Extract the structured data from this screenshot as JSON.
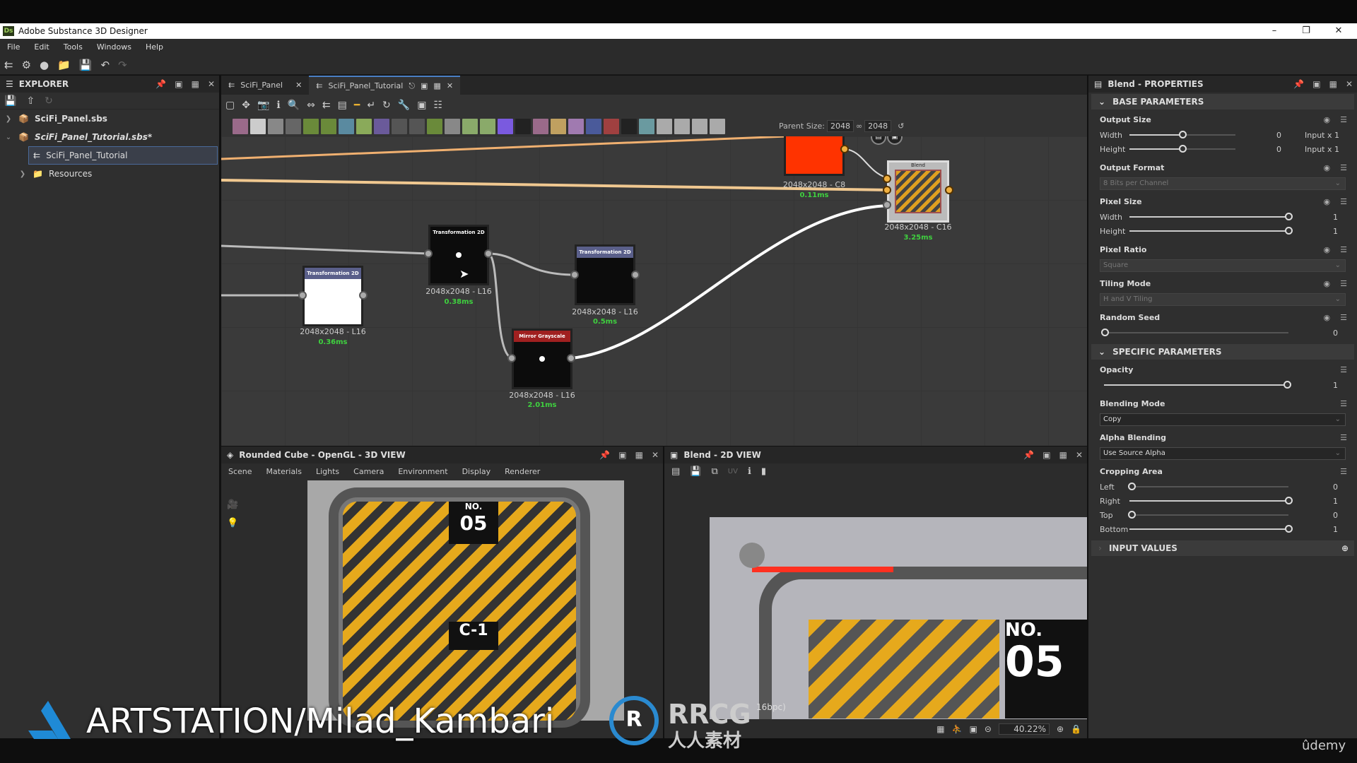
{
  "app": {
    "title": "Adobe Substance 3D Designer",
    "logo": "Ds"
  },
  "menu": [
    "File",
    "Edit",
    "Tools",
    "Windows",
    "Help"
  ],
  "explorer": {
    "title": "EXPLORER",
    "items": [
      {
        "label": "SciFi_Panel.sbs",
        "icon": "package-icon"
      },
      {
        "label": "SciFi_Panel_Tutorial.sbs*",
        "icon": "package-icon"
      },
      {
        "label": "SciFi_Panel_Tutorial",
        "icon": "graph-icon",
        "selected": true
      },
      {
        "label": "Resources",
        "icon": "folder-icon"
      }
    ]
  },
  "graph": {
    "tabs": [
      {
        "label": "SciFi_Panel"
      },
      {
        "label": "SciFi_Panel_Tutorial",
        "active": true
      }
    ],
    "parent_size_label": "Parent Size:",
    "parent_size_w": "2048",
    "parent_size_h": "2048",
    "nodes": [
      {
        "id": "red",
        "title": "",
        "res": "2048x2048 - C8",
        "time": "0.11ms",
        "color": "#ff3300"
      },
      {
        "id": "blend",
        "title": "Blend",
        "res": "2048x2048 - C16",
        "time": "3.25ms"
      },
      {
        "id": "t2d_top",
        "title": "Transformation 2D",
        "res": "2048x2048 - L16",
        "time": "0.38ms"
      },
      {
        "id": "t2d_right",
        "title": "Transformation 2D",
        "res": "2048x2048 - L16",
        "time": "0.5ms"
      },
      {
        "id": "t2d_left",
        "title": "Transformation 2D",
        "res": "2048x2048 - L16",
        "time": "0.36ms"
      },
      {
        "id": "mirror",
        "title": "Mirror Grayscale",
        "res": "2048x2048 - L16",
        "time": "2.01ms"
      }
    ]
  },
  "view3d": {
    "title": "Rounded Cube - OpenGL - 3D VIEW",
    "menu": [
      "Scene",
      "Materials",
      "Lights",
      "Camera",
      "Environment",
      "Display",
      "Renderer"
    ],
    "decal_text": "NO.",
    "decal_num": "05",
    "code": "C-1"
  },
  "view2d": {
    "title": "Blend - 2D VIEW",
    "uv": "UV",
    "info": "16bpc)",
    "zoom": "40.22%",
    "decal_text": "NO.",
    "decal_num": "05"
  },
  "properties": {
    "title": "Blend - PROPERTIES",
    "base": {
      "title": "BASE PARAMETERS",
      "output_size": {
        "label": "Output Size",
        "width_label": "Width",
        "height_label": "Height",
        "width": "0",
        "height": "0",
        "width_suffix": "Input x 1",
        "height_suffix": "Input x 1",
        "fraction": 0.5
      },
      "output_format": {
        "label": "Output Format",
        "value": "8 Bits per Channel"
      },
      "pixel_size": {
        "label": "Pixel Size",
        "width_label": "Width",
        "height_label": "Height",
        "width": "1",
        "height": "1"
      },
      "pixel_ratio": {
        "label": "Pixel Ratio",
        "value": "Square"
      },
      "tiling_mode": {
        "label": "Tiling Mode",
        "value": "H and V Tiling"
      },
      "random_seed": {
        "label": "Random Seed",
        "value": "0"
      }
    },
    "specific": {
      "title": "SPECIFIC PARAMETERS",
      "opacity": {
        "label": "Opacity",
        "value": "1"
      },
      "blending_mode": {
        "label": "Blending Mode",
        "value": "Copy"
      },
      "alpha_blending": {
        "label": "Alpha Blending",
        "value": "Use Source Alpha"
      },
      "cropping": {
        "label": "Cropping Area",
        "left_label": "Left",
        "right_label": "Right",
        "top_label": "Top",
        "bottom_label": "Bottom",
        "left": "0",
        "right": "1",
        "top": "0",
        "bottom": "1"
      }
    },
    "input_values": {
      "title": "INPUT VALUES"
    }
  },
  "watermarks": {
    "artstation": "ARTSTATION/Milad_Kambari",
    "rrcg": "RRCG",
    "rrcg_cn": "人人素材",
    "udemy": "ûdemy"
  },
  "colors": {
    "accent": "#4a7fc4",
    "timing": "#3fd13f",
    "node_header": "#5a5f8a",
    "mirror_header": "#a02020"
  }
}
